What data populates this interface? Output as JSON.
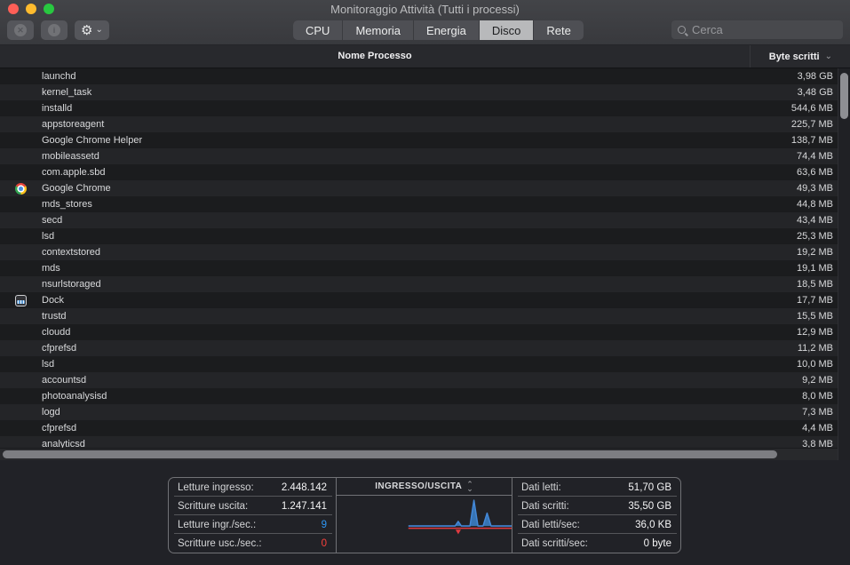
{
  "window": {
    "title": "Monitoraggio Attività (Tutti i processi)"
  },
  "colors": {
    "traffic_red": "#fe5f57",
    "traffic_yellow": "#febb2e",
    "traffic_green": "#28c840",
    "tab_selected_bg": "#b8b9bb",
    "graph_in_blue": "#4388d8",
    "graph_in_fill": "#3a7dc4",
    "graph_out_red": "#e23a40"
  },
  "icons": {
    "close": "✕",
    "info": "i",
    "gear": "⚙",
    "chevron_down": "⌄",
    "sort_down": "⌄",
    "sort_up": "⌃",
    "search": "css-magnifier"
  },
  "toolbar": {
    "tabs": [
      {
        "label": "CPU",
        "selected": false
      },
      {
        "label": "Memoria",
        "selected": false
      },
      {
        "label": "Energia",
        "selected": false
      },
      {
        "label": "Disco",
        "selected": true
      },
      {
        "label": "Rete",
        "selected": false
      }
    ],
    "search": {
      "placeholder": "Cerca",
      "value": ""
    }
  },
  "table": {
    "columns": {
      "name": "Nome Processo",
      "bytes": "Byte scritti",
      "sort_indicator": "⌄"
    },
    "rows": [
      {
        "name": "launchd",
        "value": "3,98 GB",
        "icon": ""
      },
      {
        "name": "kernel_task",
        "value": "3,48 GB",
        "icon": ""
      },
      {
        "name": "installd",
        "value": "544,6 MB",
        "icon": ""
      },
      {
        "name": "appstoreagent",
        "value": "225,7 MB",
        "icon": ""
      },
      {
        "name": "Google Chrome Helper",
        "value": "138,7 MB",
        "icon": ""
      },
      {
        "name": "mobileassetd",
        "value": "74,4 MB",
        "icon": ""
      },
      {
        "name": "com.apple.sbd",
        "value": "63,6 MB",
        "icon": ""
      },
      {
        "name": "Google Chrome",
        "value": "49,3 MB",
        "icon": "chrome"
      },
      {
        "name": "mds_stores",
        "value": "44,8 MB",
        "icon": ""
      },
      {
        "name": "secd",
        "value": "43,4 MB",
        "icon": ""
      },
      {
        "name": "lsd",
        "value": "25,3 MB",
        "icon": ""
      },
      {
        "name": "contextstored",
        "value": "19,2 MB",
        "icon": ""
      },
      {
        "name": "mds",
        "value": "19,1 MB",
        "icon": ""
      },
      {
        "name": "nsurlstoraged",
        "value": "18,5 MB",
        "icon": ""
      },
      {
        "name": "Dock",
        "value": "17,7 MB",
        "icon": "dock"
      },
      {
        "name": "trustd",
        "value": "15,5 MB",
        "icon": ""
      },
      {
        "name": "cloudd",
        "value": "12,9 MB",
        "icon": ""
      },
      {
        "name": "cfprefsd",
        "value": "11,2 MB",
        "icon": ""
      },
      {
        "name": "lsd",
        "value": "10,0 MB",
        "icon": ""
      },
      {
        "name": "accountsd",
        "value": "9,2 MB",
        "icon": ""
      },
      {
        "name": "photoanalysisd",
        "value": "8,0 MB",
        "icon": ""
      },
      {
        "name": "logd",
        "value": "7,3 MB",
        "icon": ""
      },
      {
        "name": "cfprefsd",
        "value": "4,4 MB",
        "icon": ""
      },
      {
        "name": "analyticsd",
        "value": "3,8 MB",
        "icon": ""
      }
    ]
  },
  "footer": {
    "left": [
      {
        "label": "Letture ingresso:",
        "value": "2.448.142",
        "color": ""
      },
      {
        "label": "Scritture uscita:",
        "value": "1.247.141",
        "color": ""
      },
      {
        "label": "Letture ingr./sec.:",
        "value": "9",
        "color": "#2e97f5"
      },
      {
        "label": "Scritture usc./sec.:",
        "value": "0",
        "color": "#fb413c"
      }
    ],
    "graph": {
      "title": "INGRESSO/USCITA",
      "baseline_start": 0.41,
      "spikes": [
        {
          "x": 0.695,
          "h": 5,
          "w": 7
        },
        {
          "x": 0.785,
          "h": 28,
          "w": 9
        },
        {
          "x": 0.86,
          "h": 14,
          "w": 9
        }
      ],
      "marker_x": 0.695
    },
    "right": [
      {
        "label": "Dati letti:",
        "value": "51,70 GB",
        "color": ""
      },
      {
        "label": "Dati scritti:",
        "value": "35,50 GB",
        "color": ""
      },
      {
        "label": "Dati letti/sec:",
        "value": "36,0 KB",
        "color": ""
      },
      {
        "label": "Dati scritti/sec:",
        "value": "0 byte",
        "color": ""
      }
    ]
  }
}
